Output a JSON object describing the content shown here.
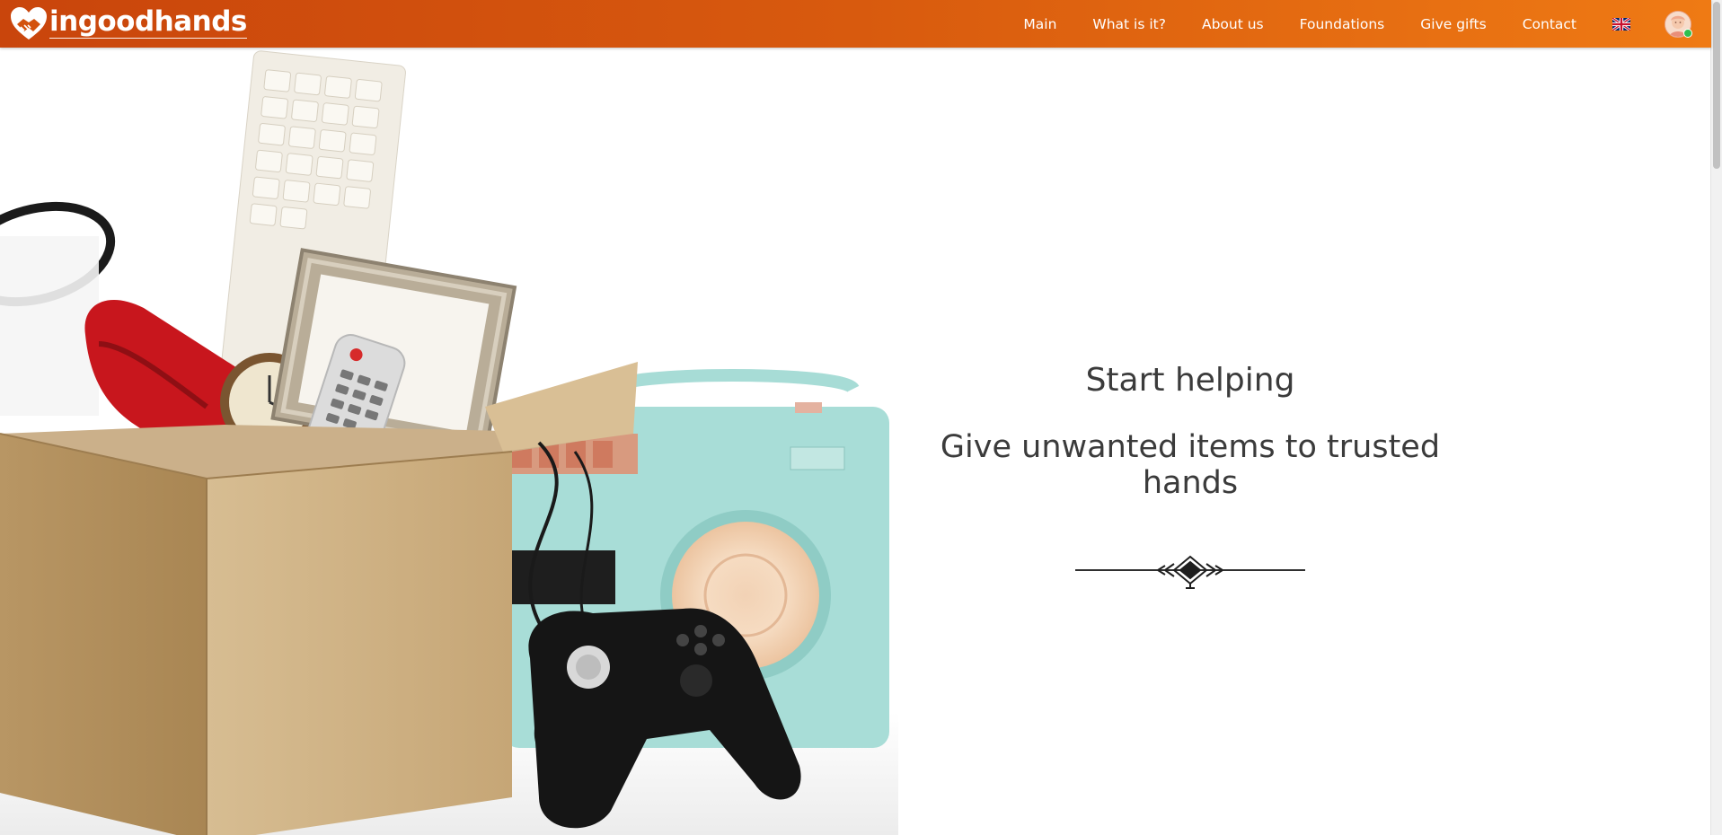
{
  "brand": {
    "name": "ingoodhands",
    "icon": "heart-handshake-icon"
  },
  "nav": {
    "items": [
      "Main",
      "What is it?",
      "About us",
      "Foundations",
      "Give gifts",
      "Contact"
    ],
    "language_icon": "uk-flag-icon",
    "user_icon": "user-avatar-icon"
  },
  "hero": {
    "title": "Start helping",
    "subtitle": "Give unwanted items to trusted hands",
    "image_icon": "box-of-donated-items-image",
    "ornament_icon": "decorative-divider-icon"
  },
  "colors": {
    "navbar_start": "#c9450c",
    "navbar_end": "#ef7a14",
    "text": "#3b3b3b"
  }
}
